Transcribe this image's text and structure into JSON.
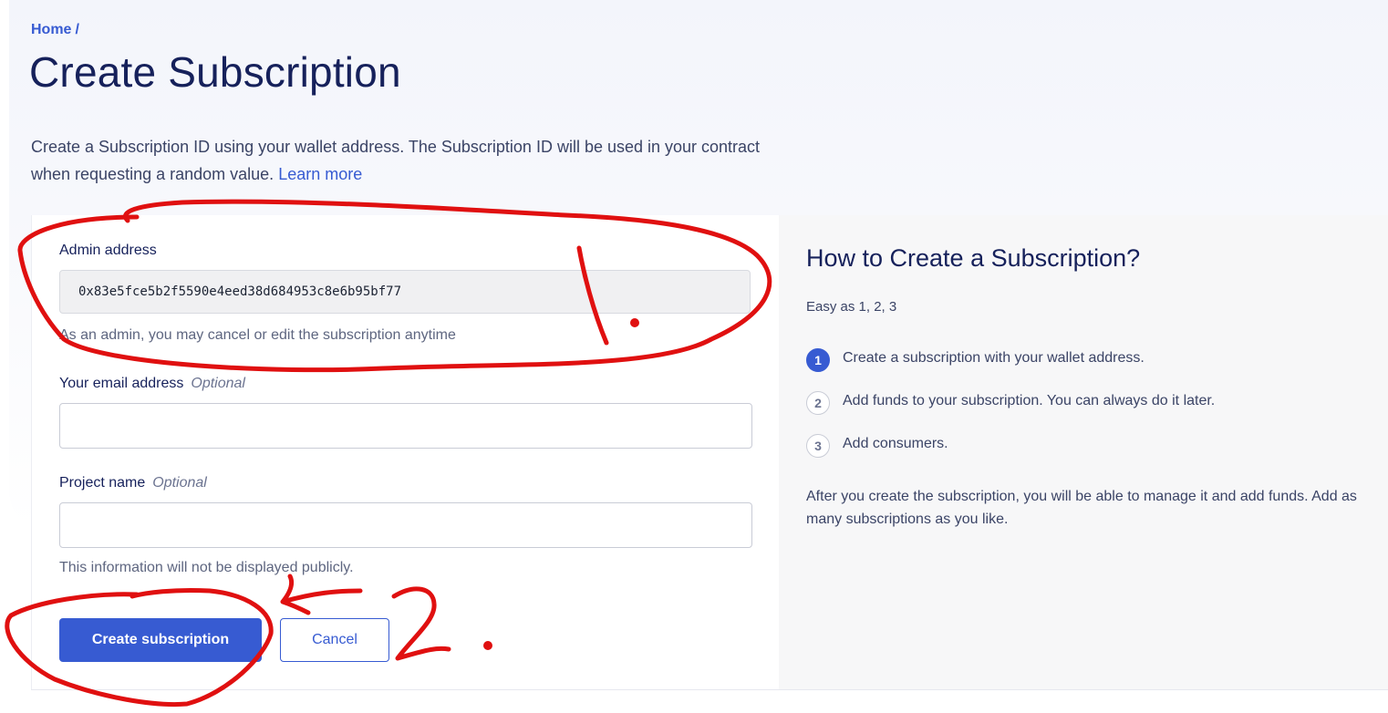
{
  "breadcrumb": {
    "home": "Home",
    "separator": "/"
  },
  "page": {
    "title": "Create Subscription",
    "intro": "Create a Subscription ID using your wallet address. The Subscription ID will be used in your contract when requesting a random value.",
    "learn_more": "Learn more"
  },
  "form": {
    "admin_label": "Admin address",
    "admin_value": "0x83e5fce5b2f5590e4eed38d684953c8e6b95bf77",
    "admin_hint": "As an admin, you may cancel or edit the subscription anytime",
    "email_label": "Your email address",
    "email_optional": "Optional",
    "email_value": "",
    "project_label": "Project name",
    "project_optional": "Optional",
    "project_value": "",
    "privacy_note": "This information will not be displayed publicly.",
    "create_button": "Create subscription",
    "cancel_button": "Cancel"
  },
  "sidebar": {
    "title": "How to Create a Subscription?",
    "subtitle": "Easy as 1, 2, 3",
    "steps": [
      {
        "number": "1",
        "text": "Create a subscription with your wallet address.",
        "active": true
      },
      {
        "number": "2",
        "text": "Add funds to your subscription. You can always do it later.",
        "active": false
      },
      {
        "number": "3",
        "text": "Add consumers.",
        "active": false
      }
    ],
    "footer": "After you create the subscription, you will be able to manage it and add funds. Add as many subscriptions as you like."
  },
  "colors": {
    "accent": "#375bd2",
    "heading": "#16215b",
    "annotation": "#e01010"
  }
}
